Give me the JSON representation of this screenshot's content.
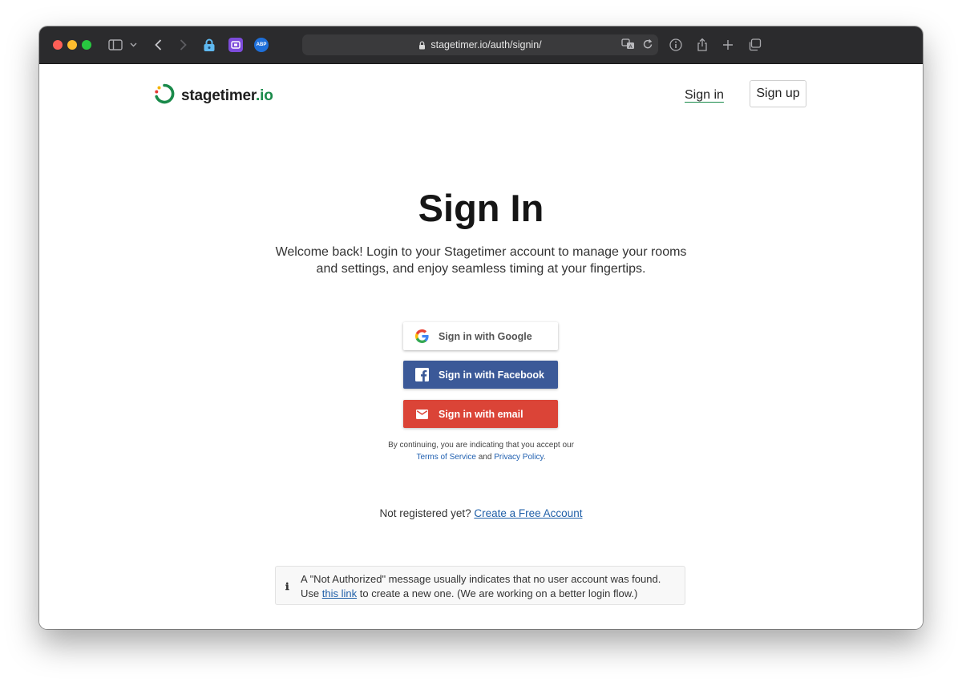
{
  "browser": {
    "url": "stagetimer.io/auth/signin/",
    "icons": [
      "sidebar-icon",
      "chevron-down-icon",
      "back-icon",
      "forward-icon",
      "lock-extension-icon",
      "purple-extension-icon",
      "abp-extension-icon",
      "lock-icon",
      "translate-icon",
      "reload-icon",
      "info-icon",
      "share-icon",
      "plus-icon",
      "tabs-icon"
    ],
    "abp_label": "ABP"
  },
  "header": {
    "logo_name": "stagetimer",
    "logo_suffix": ".io",
    "signin_label": "Sign in",
    "signup_label": "Sign up"
  },
  "main": {
    "title": "Sign In",
    "subtitle": "Welcome back! Login to your Stagetimer account to manage your rooms and settings, and enjoy seamless timing at your fingertips."
  },
  "auth": {
    "google_label": "Sign in with Google",
    "facebook_label": "Sign in with Facebook",
    "email_label": "Sign in with email",
    "terms_prefix": "By continuing, you are indicating that you accept our",
    "terms_link": "Terms of Service",
    "terms_and": "and",
    "privacy_link": "Privacy Policy",
    "terms_end": "."
  },
  "register": {
    "prompt": "Not registered yet?",
    "link": "Create a Free Account"
  },
  "notice": {
    "icon": "info-icon",
    "line1": "A \"Not Authorized\" message usually indicates that no user account was found.",
    "prefix": "Use",
    "link": "this link",
    "suffix": "to create a new one. (We are working on a better login flow.)"
  },
  "colors": {
    "brand_green": "#1a8a4a",
    "facebook_blue": "#3b5998",
    "email_red": "#db4437",
    "link_blue": "#1f5fa8"
  }
}
